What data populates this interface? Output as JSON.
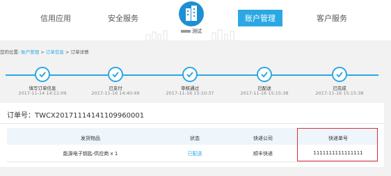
{
  "nav": {
    "items": [
      "信用应用",
      "安全服务",
      "账户管理",
      "客户服务"
    ],
    "logo_sub": "测试"
  },
  "breadcrumb": {
    "prefix": "您的位置:",
    "items": [
      "账户管理",
      "订单信息",
      "订单详情"
    ],
    "separator": ">"
  },
  "progress": {
    "steps": [
      {
        "label": "填写订单信息",
        "time": "2017-11-14 14:11:09"
      },
      {
        "label": "已支付",
        "time": "2017-11-16 14:40:49"
      },
      {
        "label": "审核通过",
        "time": "2017-11-16 15:10:37"
      },
      {
        "label": "已配送",
        "time": "2017-11-16 15:15:38"
      },
      {
        "label": "已完成",
        "time": "2017-11-16 15:15:38"
      }
    ]
  },
  "order": {
    "number_label": "订单号：",
    "number": "TWCX20171114141109960001"
  },
  "table": {
    "headers": [
      "发货物品",
      "状态",
      "快递公司",
      "快递单号"
    ],
    "rows": [
      [
        "能源电子钥匙-供应商 x 1",
        "已配送",
        "顺丰快递",
        "1111111111111111"
      ]
    ]
  },
  "colors": {
    "accent": "#2ba8e3",
    "highlight": "#d9303a"
  }
}
